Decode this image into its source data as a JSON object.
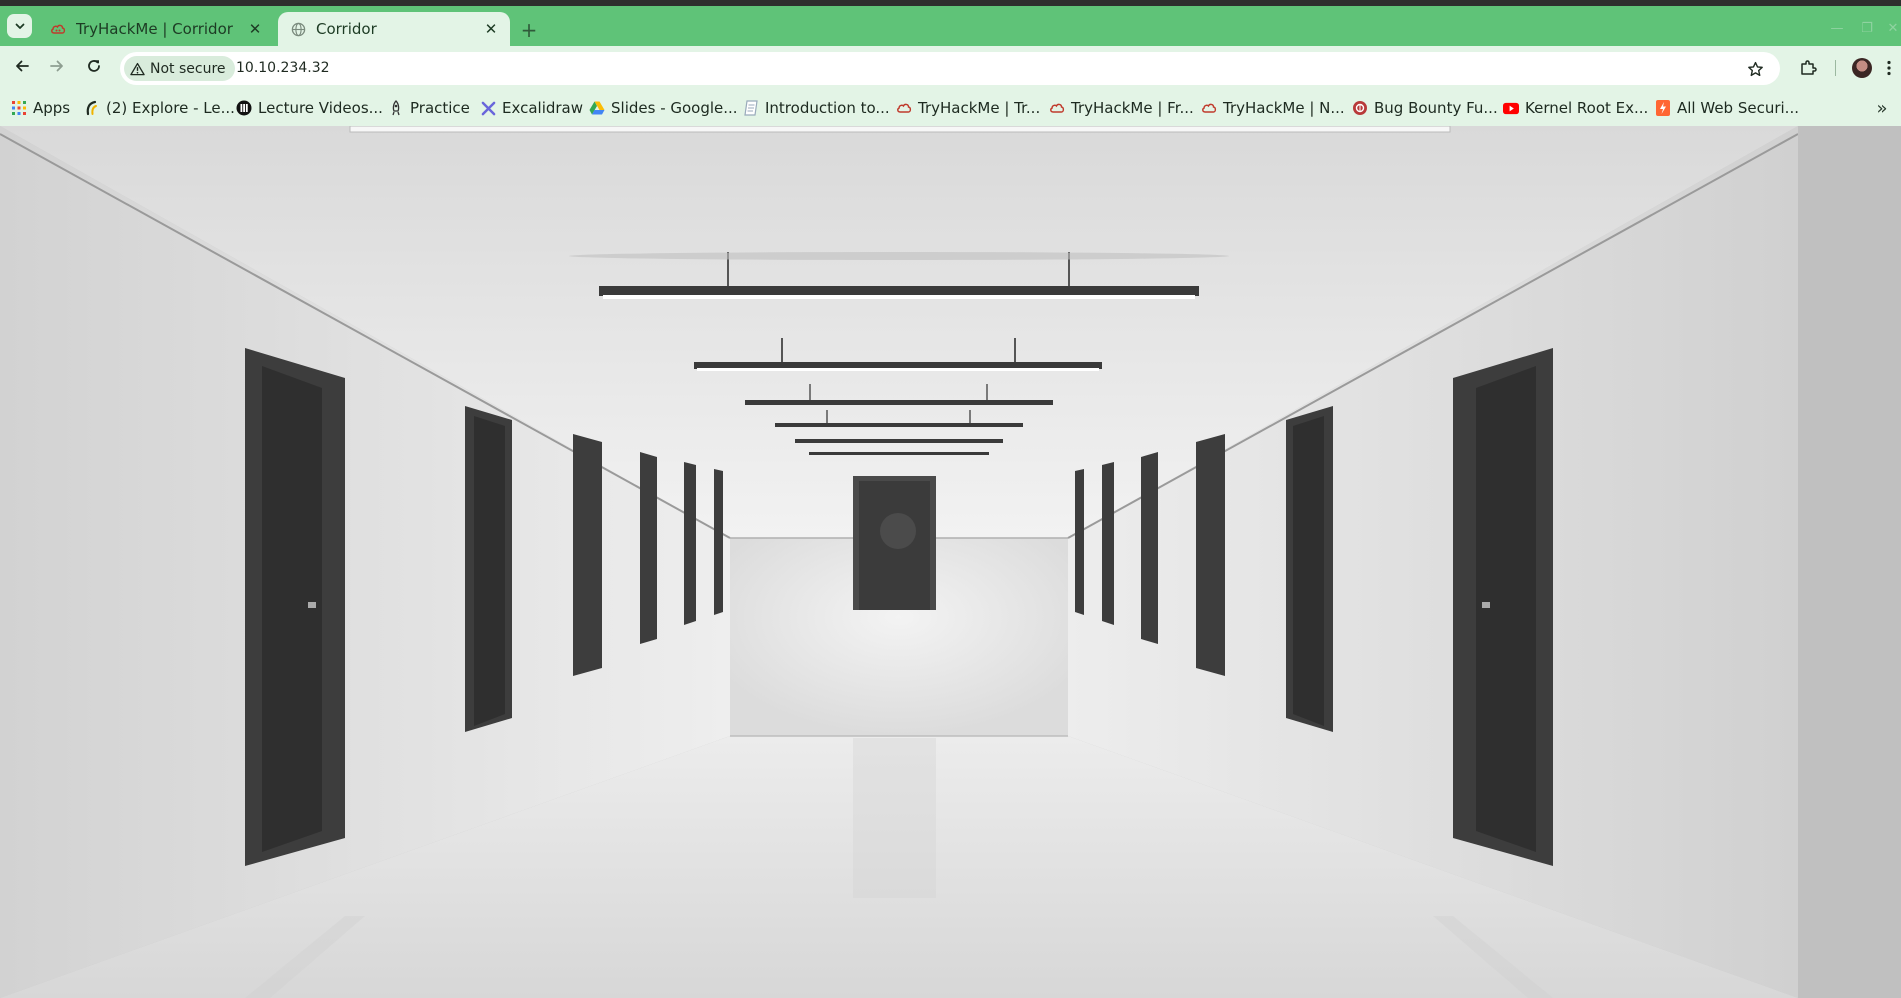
{
  "browser": {
    "tabs": [
      {
        "title": "TryHackMe | Corridor",
        "active": false,
        "favicon": "tryhackme-cloud-icon"
      },
      {
        "title": "Corridor",
        "active": true,
        "favicon": "globe-icon"
      }
    ],
    "new_tab_label": "+",
    "address_bar": {
      "security_label": "Not secure",
      "url": "10.10.234.32"
    },
    "bookmarks": [
      {
        "label": "Apps",
        "icon": "apps-grid-icon"
      },
      {
        "label": "(2) Explore - Le...",
        "icon": "explore-icon"
      },
      {
        "label": "Lecture Videos...",
        "icon": "lecture-icon"
      },
      {
        "label": "Practice",
        "icon": "rocket-icon"
      },
      {
        "label": "Excalidraw",
        "icon": "excalidraw-icon"
      },
      {
        "label": "Slides - Google...",
        "icon": "google-drive-icon"
      },
      {
        "label": "Introduction to...",
        "icon": "document-icon"
      },
      {
        "label": "TryHackMe | Tr...",
        "icon": "tryhackme-cloud-icon"
      },
      {
        "label": "TryHackMe | Fr...",
        "icon": "tryhackme-cloud-icon"
      },
      {
        "label": "TryHackMe | N...",
        "icon": "tryhackme-cloud-icon"
      },
      {
        "label": "Bug Bounty Fu...",
        "icon": "bug-bounty-icon"
      },
      {
        "label": "Kernel Root Ex...",
        "icon": "youtube-icon"
      },
      {
        "label": "All Web Securi...",
        "icon": "burp-icon"
      }
    ],
    "bookmarks_overflow_label": "»"
  },
  "page": {
    "image": "white-corridor-with-doors"
  },
  "colors": {
    "frame_green": "#5fc378",
    "toolbar_bg": "#e3f4e6",
    "door": "#3a3a3a",
    "wall": "#e6e6e6"
  }
}
